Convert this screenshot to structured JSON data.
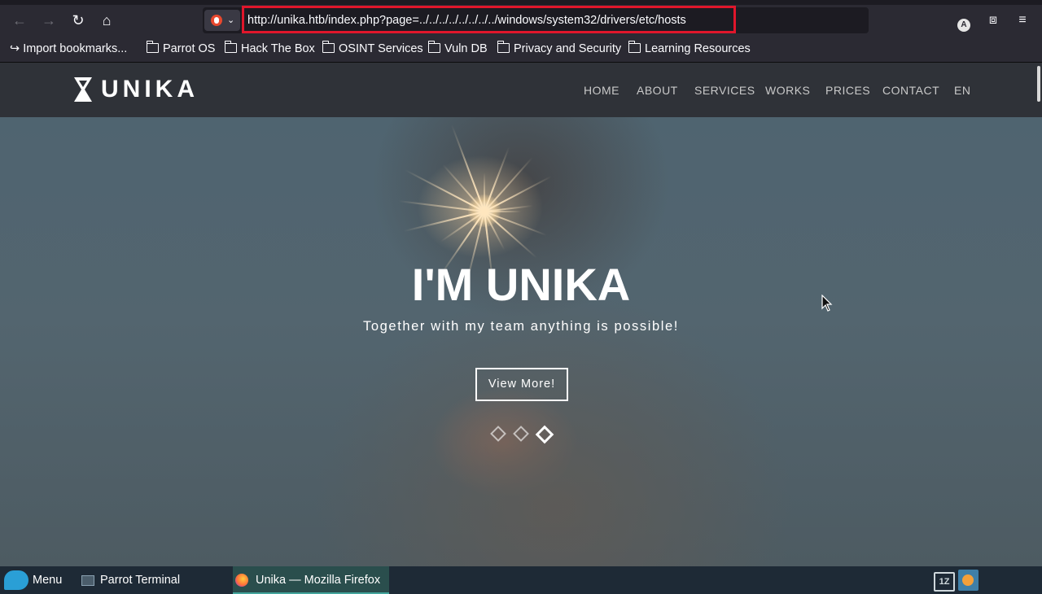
{
  "browser": {
    "url": "http://unika.htb/index.php?page=../../../../../../../../windows/system32/drivers/etc/hosts",
    "account_initial": "A",
    "bookmarks": [
      {
        "label": "Import bookmarks...",
        "icon": "import-icon"
      },
      {
        "label": "Parrot OS",
        "icon": "folder-icon"
      },
      {
        "label": "Hack The Box",
        "icon": "folder-icon"
      },
      {
        "label": "OSINT Services",
        "icon": "folder-icon"
      },
      {
        "label": "Vuln DB",
        "icon": "folder-icon"
      },
      {
        "label": "Privacy and Security",
        "icon": "folder-icon"
      },
      {
        "label": "Learning Resources",
        "icon": "folder-icon"
      }
    ],
    "highlight_color": "#e0162b"
  },
  "site": {
    "logo": "UNIKA",
    "menu": [
      "HOME",
      "ABOUT",
      "SERVICES",
      "WORKS",
      "PRICES",
      "CONTACT",
      "EN"
    ],
    "hero": {
      "title": "I'M UNIKA",
      "subtitle": "Together with my team anything is possible!",
      "button": "View More!",
      "slides": 3,
      "active_slide": 3
    }
  },
  "taskbar": {
    "menu_label": "Menu",
    "apps": [
      {
        "label": "Parrot Terminal",
        "active": false
      },
      {
        "label": "Unika — Mozilla Firefox",
        "active": true
      }
    ]
  }
}
